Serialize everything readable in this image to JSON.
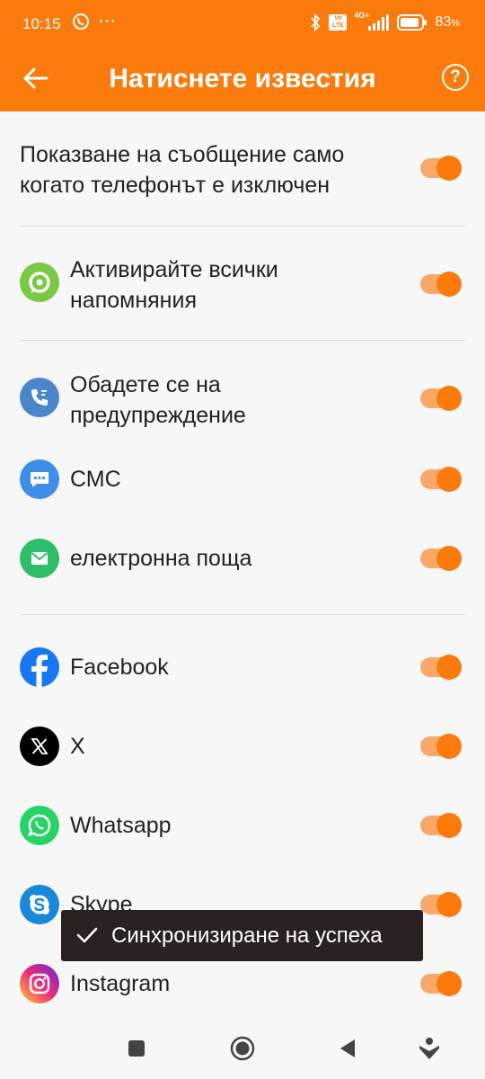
{
  "status_bar": {
    "time": "10:15",
    "more": "···",
    "battery_percent": "83",
    "battery_unit": "%",
    "network_label": "4G+",
    "volte_label": "Vo LTE"
  },
  "app_bar": {
    "title": "Натиснете известия"
  },
  "settings": {
    "phone_off_label": "Показване на съобщение само когато телефонът е изключен",
    "all_reminders_label": "Активирайте всички напомняния",
    "call_alert_label": "Обадете се на предупреждение",
    "sms_label": "СМС",
    "email_label": "електронна поща",
    "apps": [
      {
        "label": "Facebook",
        "icon": "facebook-icon",
        "color": "#1877f2"
      },
      {
        "label": "X",
        "icon": "x-icon",
        "color": "#000000"
      },
      {
        "label": "Whatsapp",
        "icon": "whatsapp-icon",
        "color": "#25d366"
      },
      {
        "label": "Skype",
        "icon": "skype-icon",
        "color": "#1a88d8"
      },
      {
        "label": "Instagram",
        "icon": "instagram-icon",
        "color": "#d62976"
      }
    ],
    "toggles_on": true
  },
  "toast": {
    "text": "Синхронизиране на успеха"
  },
  "colors": {
    "accent": "#fb7a0c",
    "toggle_track": "#f8a868",
    "reminder_icon": "#7ac943",
    "call_icon": "#4a86c8",
    "sms_icon": "#3d8ee6",
    "email_icon": "#2ebd6b"
  },
  "icons": {
    "back": "arrow-left-icon",
    "help": "help-circle-icon",
    "reminder": "bell-check-icon",
    "call": "phone-icon",
    "sms": "chat-bubble-icon",
    "email": "envelope-icon"
  }
}
